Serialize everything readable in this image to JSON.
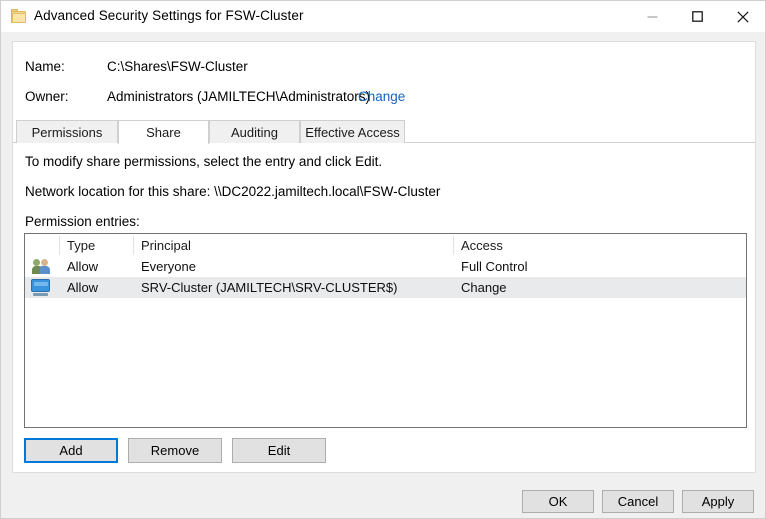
{
  "window": {
    "title": "Advanced Security Settings for FSW-Cluster",
    "icon": "folder-icon",
    "controls": {
      "minimize": "minimize-icon",
      "maximize": "maximize-icon",
      "close": "close-icon"
    }
  },
  "header": {
    "name_label": "Name:",
    "name_value": "C:\\Shares\\FSW-Cluster",
    "owner_label": "Owner:",
    "owner_value": "Administrators (JAMILTECH\\Administrators)",
    "change_link": "Change"
  },
  "tabs": [
    {
      "label": "Permissions",
      "selected": false
    },
    {
      "label": "Share",
      "selected": true
    },
    {
      "label": "Auditing",
      "selected": false
    },
    {
      "label": "Effective Access",
      "selected": false
    }
  ],
  "share_tab": {
    "instruction": "To modify share permissions, select the entry and click Edit.",
    "network_location": "Network location for this share:  \\\\DC2022.jamiltech.local\\FSW-Cluster",
    "entries_label": "Permission entries:"
  },
  "list": {
    "columns": [
      "",
      "Type",
      "Principal",
      "Access"
    ],
    "rows": [
      {
        "icon": "group-icon",
        "type": "Allow",
        "principal": "Everyone",
        "access": "Full Control",
        "selected": false
      },
      {
        "icon": "computer-icon",
        "type": "Allow",
        "principal": "SRV-Cluster (JAMILTECH\\SRV-CLUSTER$)",
        "access": "Change",
        "selected": true
      }
    ]
  },
  "entry_buttons": {
    "add": "Add",
    "remove": "Remove",
    "edit": "Edit"
  },
  "dialog_buttons": {
    "ok": "OK",
    "cancel": "Cancel",
    "apply": "Apply"
  },
  "colors": {
    "link": "#1565c0",
    "focus": "#0078d7",
    "selection": "#e9eaec",
    "panel": "#ffffff",
    "chrome": "#f0f0f0"
  }
}
